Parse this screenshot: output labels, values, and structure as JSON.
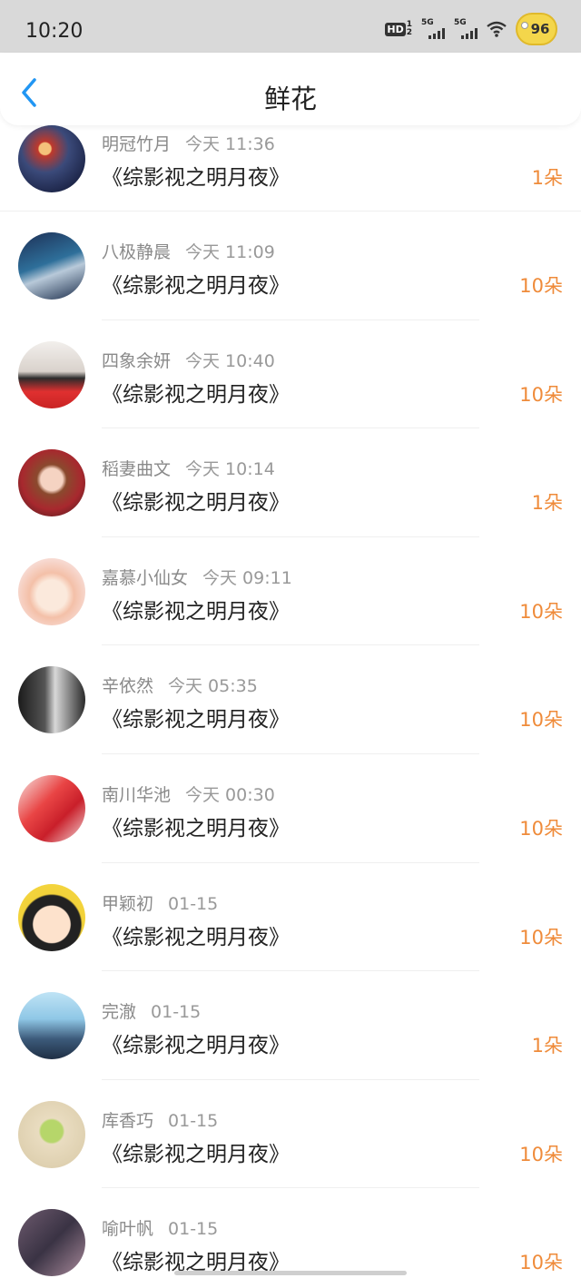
{
  "status_bar": {
    "time": "10:20",
    "hd_label": "HD",
    "hd_sub_top": "1",
    "hd_sub_bottom": "2",
    "signal_1_label": "5G",
    "signal_2_label": "5G",
    "battery_level": "96"
  },
  "nav": {
    "back_icon": "chevron-left-icon",
    "title": "鲜花"
  },
  "colors": {
    "accent_blue": "#2196f3",
    "count_orange": "#ef8b3a"
  },
  "items": [
    {
      "user": "明冠竹月",
      "time": "今天 11:36",
      "book": "《综影视之明月夜》",
      "count": "1朵"
    },
    {
      "user": "八极静晨",
      "time": "今天 11:09",
      "book": "《综影视之明月夜》",
      "count": "10朵"
    },
    {
      "user": "四象余妍",
      "time": "今天 10:40",
      "book": "《综影视之明月夜》",
      "count": "10朵"
    },
    {
      "user": "稻妻曲文",
      "time": "今天 10:14",
      "book": "《综影视之明月夜》",
      "count": "1朵"
    },
    {
      "user": "嘉慕小仙女",
      "time": "今天 09:11",
      "book": "《综影视之明月夜》",
      "count": "10朵"
    },
    {
      "user": "辛依然",
      "time": "今天 05:35",
      "book": "《综影视之明月夜》",
      "count": "10朵"
    },
    {
      "user": "南川华池",
      "time": "今天 00:30",
      "book": "《综影视之明月夜》",
      "count": "10朵"
    },
    {
      "user": "甲颖初",
      "time": "01-15",
      "book": "《综影视之明月夜》",
      "count": "10朵"
    },
    {
      "user": "完澈",
      "time": "01-15",
      "book": "《综影视之明月夜》",
      "count": "1朵"
    },
    {
      "user": "库香巧",
      "time": "01-15",
      "book": "《综影视之明月夜》",
      "count": "10朵"
    },
    {
      "user": "喻叶帆",
      "time": "01-15",
      "book": "《综影视之明月夜》",
      "count": "10朵"
    }
  ]
}
